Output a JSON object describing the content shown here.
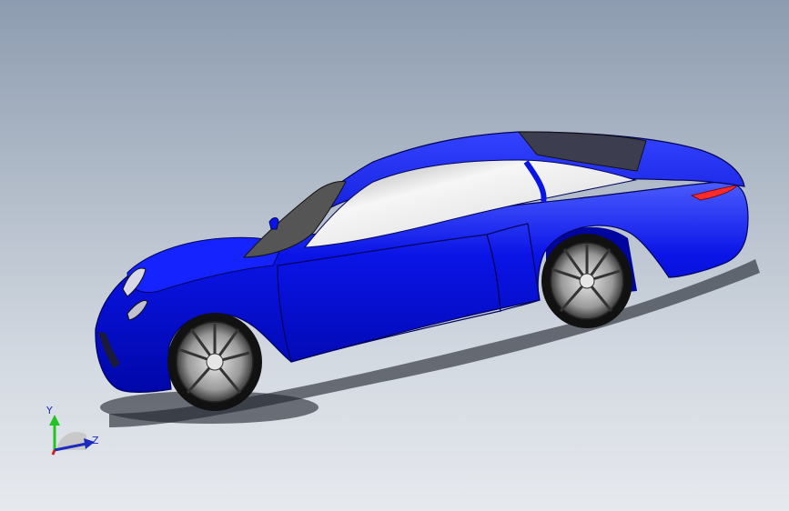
{
  "viewport": {
    "background_top": "#8d9cb0",
    "background_bottom": "#e6e9ee"
  },
  "model": {
    "body_color": "#0a14e6",
    "body_highlight": "#5a6cff",
    "body_shadow": "#0008a0",
    "glass_color": "#f1f1f1",
    "glass_shadow": "#8a8a8a",
    "tyre_color": "#111111",
    "rim_color": "#c9c9c9",
    "tail_light_color": "#ff2a2a"
  },
  "triad": {
    "y_label": "Y",
    "z_label": "Z",
    "y_color": "#22c322",
    "z_color": "#1b2bbf",
    "x_color": "#d21e1e"
  }
}
